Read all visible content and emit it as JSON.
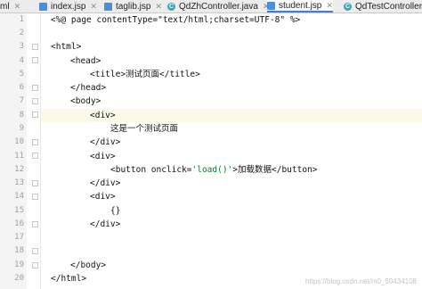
{
  "tabs": [
    {
      "label": "ml",
      "icon": "file-icon"
    },
    {
      "label": "index.jsp",
      "icon": "jsp-file-icon"
    },
    {
      "label": "taglib.jsp",
      "icon": "jsp-file-icon"
    },
    {
      "label": "QdZhController.java",
      "icon": "java-class-icon"
    },
    {
      "label": "student.jsp",
      "icon": "jsp-file-icon"
    },
    {
      "label": "QdTestController.",
      "icon": "java-class-icon"
    }
  ],
  "editor": {
    "line_numbers": [
      "1",
      "2",
      "3",
      "4",
      "5",
      "6",
      "7",
      "8",
      "9",
      "10",
      "11",
      "12",
      "13",
      "14",
      "15",
      "16",
      "17",
      "18",
      "19",
      "20"
    ],
    "lines": {
      "l1": "<%@ page contentType=\"text/html;charset=UTF-8\" %>",
      "l3": "<html>",
      "l4": "<head>",
      "l5": "<title>测试页面</title>",
      "l6": "</head>",
      "l7": "<body>",
      "l8": "<div>",
      "l9": "这是一个测试页面",
      "l10": "</div>",
      "l11": "<div>",
      "l12a": "<button onclick=",
      "l12b": "'load()'",
      "l12c": ">加载数据</button>",
      "l13": "</div>",
      "l14": "<div>",
      "l15": "{}",
      "l16": "</div>",
      "l19": "</body>",
      "l20": "</html>"
    }
  },
  "watermark": "https://blog.csdn.net/m0_50434108",
  "colors": {
    "active_tab_underline": "#3d7ee6",
    "current_line": "#fbf9e8",
    "string": "#0a7a2a"
  }
}
